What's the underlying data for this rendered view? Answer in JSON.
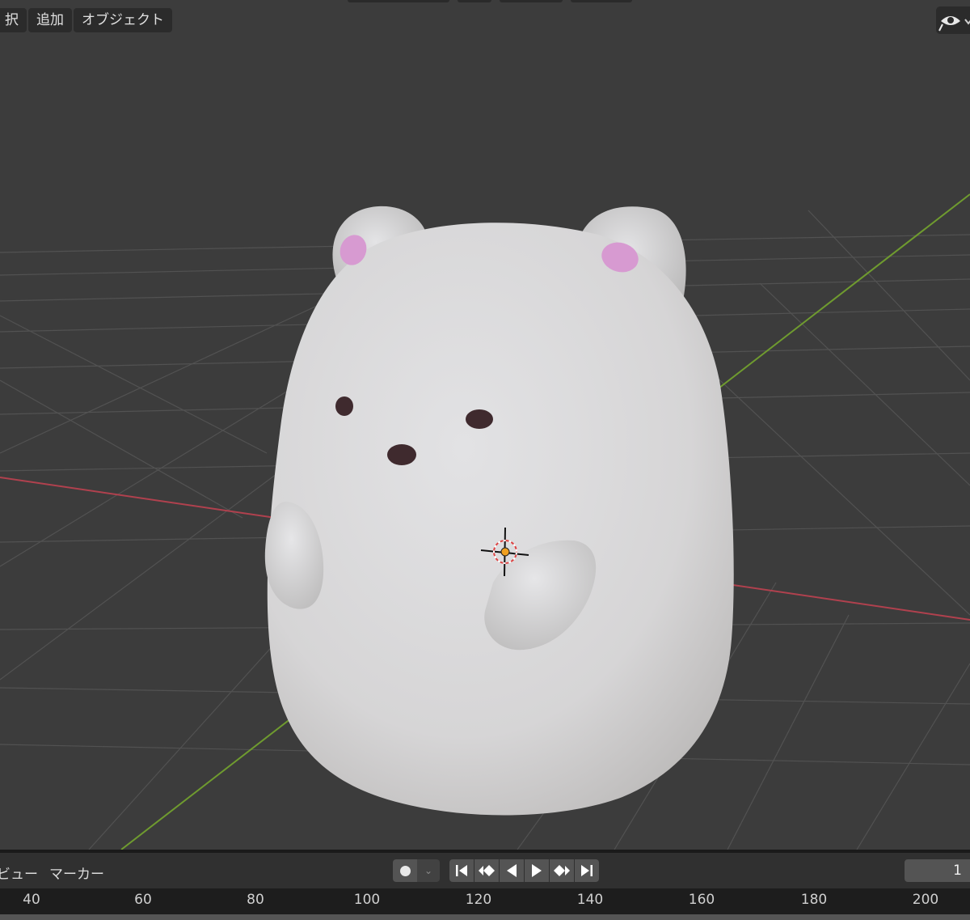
{
  "header_menu": {
    "select_label": "択",
    "add_label": "追加",
    "object_label": "オブジェクト"
  },
  "timeline": {
    "view_label": "ビュー",
    "marker_label": "マーカー",
    "current_frame": "1",
    "ruler_ticks": [
      "40",
      "60",
      "80",
      "100",
      "120",
      "140",
      "160",
      "180",
      "200"
    ]
  },
  "icons": {
    "visibility": "eye-icon",
    "record": "record-dot-icon",
    "dropdown": "chevron-down-icon",
    "jump_start": "jump-start-icon",
    "prev_keyframe": "prev-keyframe-icon",
    "play_reverse": "play-reverse-icon",
    "play": "play-icon",
    "next_keyframe": "next-keyframe-icon",
    "jump_end": "jump-end-icon",
    "cursor": "3d-cursor-icon"
  },
  "colors": {
    "x_axis": "#b0414e",
    "y_axis": "#6f9b2f",
    "grid": "#555555",
    "model": "#d8d8d8",
    "ear_inner": "#d79ad1",
    "eye": "#3f2a2e"
  }
}
